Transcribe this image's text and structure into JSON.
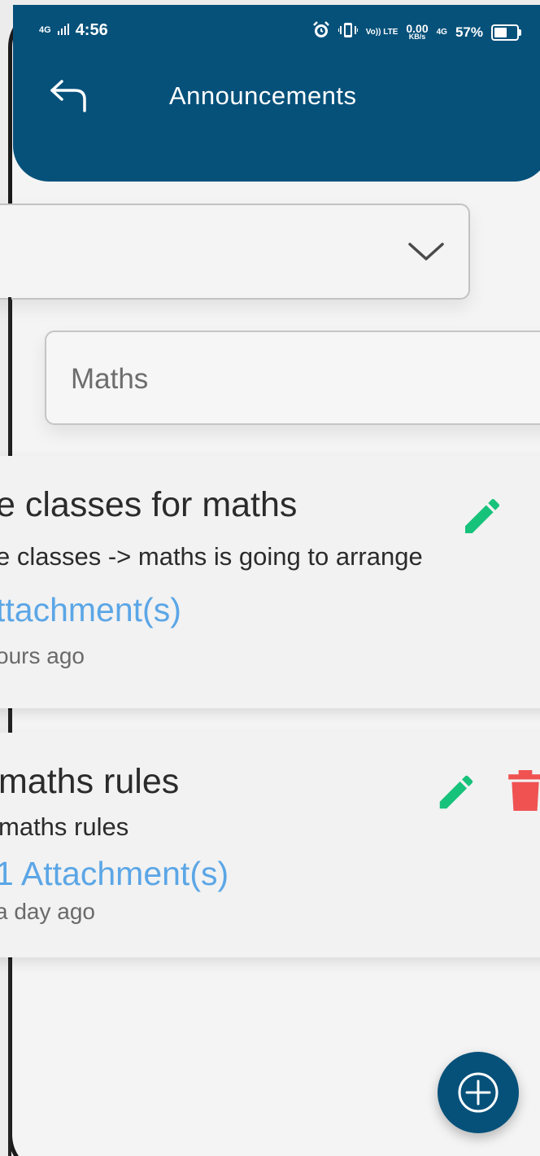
{
  "status_bar": {
    "network_left": "4G",
    "time": "4:56",
    "volte": "Vo)) LTE",
    "speed_value": "0.00",
    "speed_unit": "KB/s",
    "network_right": "4G",
    "battery": "57%"
  },
  "header": {
    "title": "Announcements"
  },
  "filters": {
    "subject_value": "Maths"
  },
  "announcements": [
    {
      "title": "e classes for maths",
      "body": "e classes -> maths is going to arrange",
      "attachments": "ttachment(s)",
      "time": "ours ago"
    },
    {
      "title": "maths rules",
      "body": "maths rules",
      "attachments": "1 Attachment(s)",
      "time": "a day ago"
    }
  ],
  "colors": {
    "primary": "#06517a",
    "edit": "#17c27b",
    "delete": "#f05252",
    "link": "#5ba6e6"
  },
  "icons": {
    "back": "back-arrow-icon",
    "dropdown": "chevron-down-icon",
    "edit": "pencil-icon",
    "delete": "trash-icon",
    "add": "plus-circle-icon"
  }
}
